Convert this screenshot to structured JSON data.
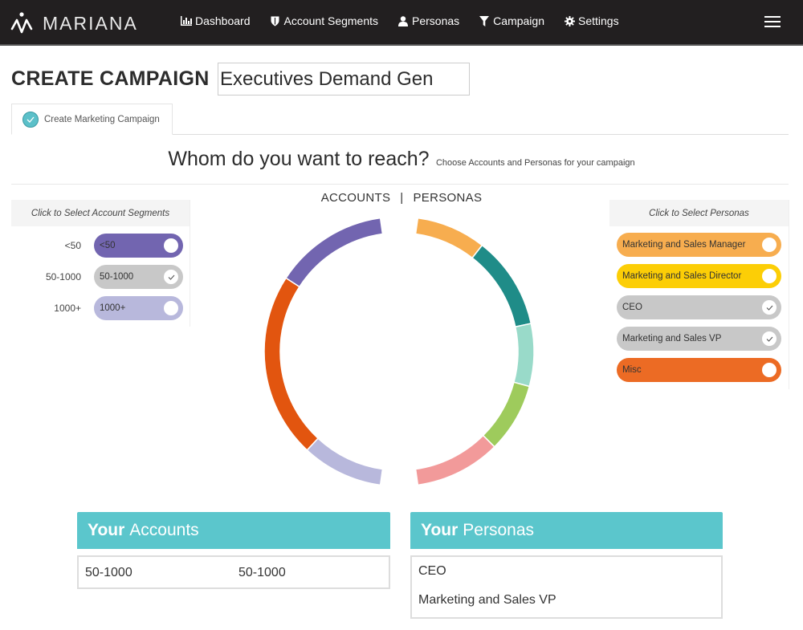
{
  "nav": {
    "brand": "MARIANA",
    "items": [
      {
        "label": "Dashboard",
        "icon": "bar-chart-icon"
      },
      {
        "label": "Account Segments",
        "icon": "shield-icon"
      },
      {
        "label": "Personas",
        "icon": "user-icon"
      },
      {
        "label": "Campaign",
        "icon": "filter-icon"
      },
      {
        "label": "Settings",
        "icon": "gear-icon"
      }
    ],
    "menu_icon": "hamburger-icon"
  },
  "page": {
    "title": "CREATE CAMPAIGN",
    "campaign_name": "Executives Demand Gen"
  },
  "tabs": [
    {
      "label": "Create Marketing Campaign",
      "icon": "check-circle-icon",
      "complete": true
    }
  ],
  "question": {
    "title": "Whom do you want to reach?",
    "subtitle": "Choose Accounts and Personas for your campaign"
  },
  "chart_toggle": {
    "accounts": "ACCOUNTS",
    "separator": "|",
    "personas": "PERSONAS"
  },
  "account_segments": {
    "header": "Click to Select Account Segments",
    "items": [
      {
        "label": "<50",
        "pill_label": "<50",
        "color": "#7265b0",
        "selected": false
      },
      {
        "label": "50-1000",
        "pill_label": "50-1000",
        "color": "#c8c8c8",
        "selected": true
      },
      {
        "label": "1000+",
        "pill_label": "1000+",
        "color": "#b8b8dc",
        "selected": false
      }
    ]
  },
  "personas": {
    "header": "Click to Select Personas",
    "items": [
      {
        "label": "Marketing and Sales Manager",
        "color": "#f7ad4f",
        "selected": false
      },
      {
        "label": "Marketing and Sales Director",
        "color": "#fcce06",
        "selected": false
      },
      {
        "label": "CEO",
        "color": "#c8c8c8",
        "selected": true
      },
      {
        "label": "Marketing and Sales VP",
        "color": "#c8c8c8",
        "selected": true
      },
      {
        "label": "Misc",
        "color": "#ec6b24",
        "selected": false
      }
    ]
  },
  "chart_data": {
    "type": "pie",
    "title": "ACCOUNTS | PERSONAS",
    "series": [
      {
        "name": "Accounts",
        "side": "left",
        "slices": [
          {
            "label": "<50",
            "start_deg": 303,
            "end_deg": 352,
            "color": "#7265b0"
          },
          {
            "label": "unlabeled segment (red-orange)",
            "start_deg": 223,
            "end_deg": 303,
            "color": "#e2550f"
          },
          {
            "label": "1000+",
            "start_deg": 188,
            "end_deg": 223,
            "color": "#b8b8dc"
          }
        ]
      },
      {
        "name": "Personas",
        "side": "right",
        "slices": [
          {
            "label": "Marketing and Sales Manager",
            "start_deg": 8,
            "end_deg": 38,
            "color": "#f7ad4f"
          },
          {
            "label": "unlabeled segment (teal)",
            "start_deg": 38,
            "end_deg": 78,
            "color": "#1f8c88"
          },
          {
            "label": "unlabeled segment (mint)",
            "start_deg": 78,
            "end_deg": 105,
            "color": "#99dac9"
          },
          {
            "label": "unlabeled segment (green)",
            "start_deg": 105,
            "end_deg": 135,
            "color": "#9ecb5c"
          },
          {
            "label": "unlabeled segment (pink)",
            "start_deg": 135,
            "end_deg": 172,
            "color": "#f29a9a"
          }
        ]
      }
    ]
  },
  "summary": {
    "accounts": {
      "title_bold": "Your",
      "title_rest": "Accounts",
      "values": [
        "50-1000",
        "50-1000"
      ]
    },
    "personas": {
      "title_bold": "Your",
      "title_rest": "Personas",
      "values": [
        "CEO",
        "Marketing and Sales VP"
      ]
    }
  },
  "colors": {
    "nav_bg": "#221f20",
    "accent": "#5bc6cc"
  }
}
